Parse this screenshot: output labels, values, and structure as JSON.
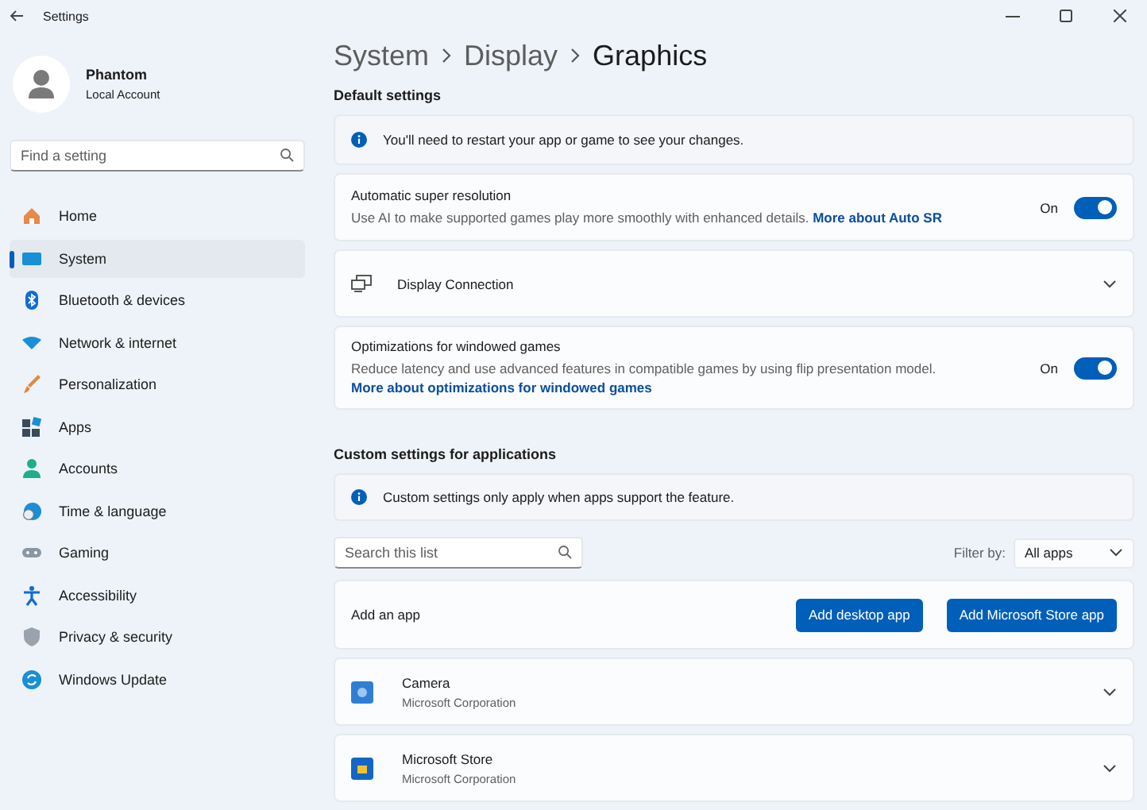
{
  "window": {
    "title": "Settings"
  },
  "account": {
    "name": "Phantom",
    "type": "Local Account"
  },
  "search": {
    "placeholder": "Find a setting"
  },
  "sidebar": {
    "items": [
      {
        "label": "Home",
        "selected": false
      },
      {
        "label": "System",
        "selected": true
      },
      {
        "label": "Bluetooth & devices",
        "selected": false
      },
      {
        "label": "Network & internet",
        "selected": false
      },
      {
        "label": "Personalization",
        "selected": false
      },
      {
        "label": "Apps",
        "selected": false
      },
      {
        "label": "Accounts",
        "selected": false
      },
      {
        "label": "Time & language",
        "selected": false
      },
      {
        "label": "Gaming",
        "selected": false
      },
      {
        "label": "Accessibility",
        "selected": false
      },
      {
        "label": "Privacy & security",
        "selected": false
      },
      {
        "label": "Windows Update",
        "selected": false
      }
    ]
  },
  "breadcrumb": [
    "System",
    "Display",
    "Graphics"
  ],
  "default_settings": {
    "heading": "Default settings",
    "info": "You'll need to restart your app or game to see your changes.",
    "items": [
      {
        "kind": "toggle",
        "title": "Automatic super resolution",
        "description": "Use AI to make supported games play more smoothly with enhanced details.",
        "link": "More about Auto SR",
        "state_label": "On",
        "on": true
      },
      {
        "kind": "expander",
        "title": "Display Connection",
        "expanded": false
      },
      {
        "kind": "toggle",
        "title": "Optimizations for windowed games",
        "description": "Reduce latency and use advanced features in compatible games by using flip presentation model.",
        "link": "More about optimizations for windowed games",
        "state_label": "On",
        "on": true
      }
    ]
  },
  "custom_settings": {
    "heading": "Custom settings for applications",
    "info": "Custom settings only apply when apps support the feature.",
    "search_placeholder": "Search this list",
    "filter_label": "Filter by:",
    "filter_value": "All apps",
    "add_label": "Add an app",
    "buttons": [
      "Add desktop app",
      "Add Microsoft Store app"
    ],
    "apps": [
      {
        "name": "Camera",
        "publisher": "Microsoft Corporation",
        "expanded": false
      },
      {
        "name": "Microsoft Store",
        "publisher": "Microsoft Corporation",
        "expanded": false
      }
    ]
  }
}
